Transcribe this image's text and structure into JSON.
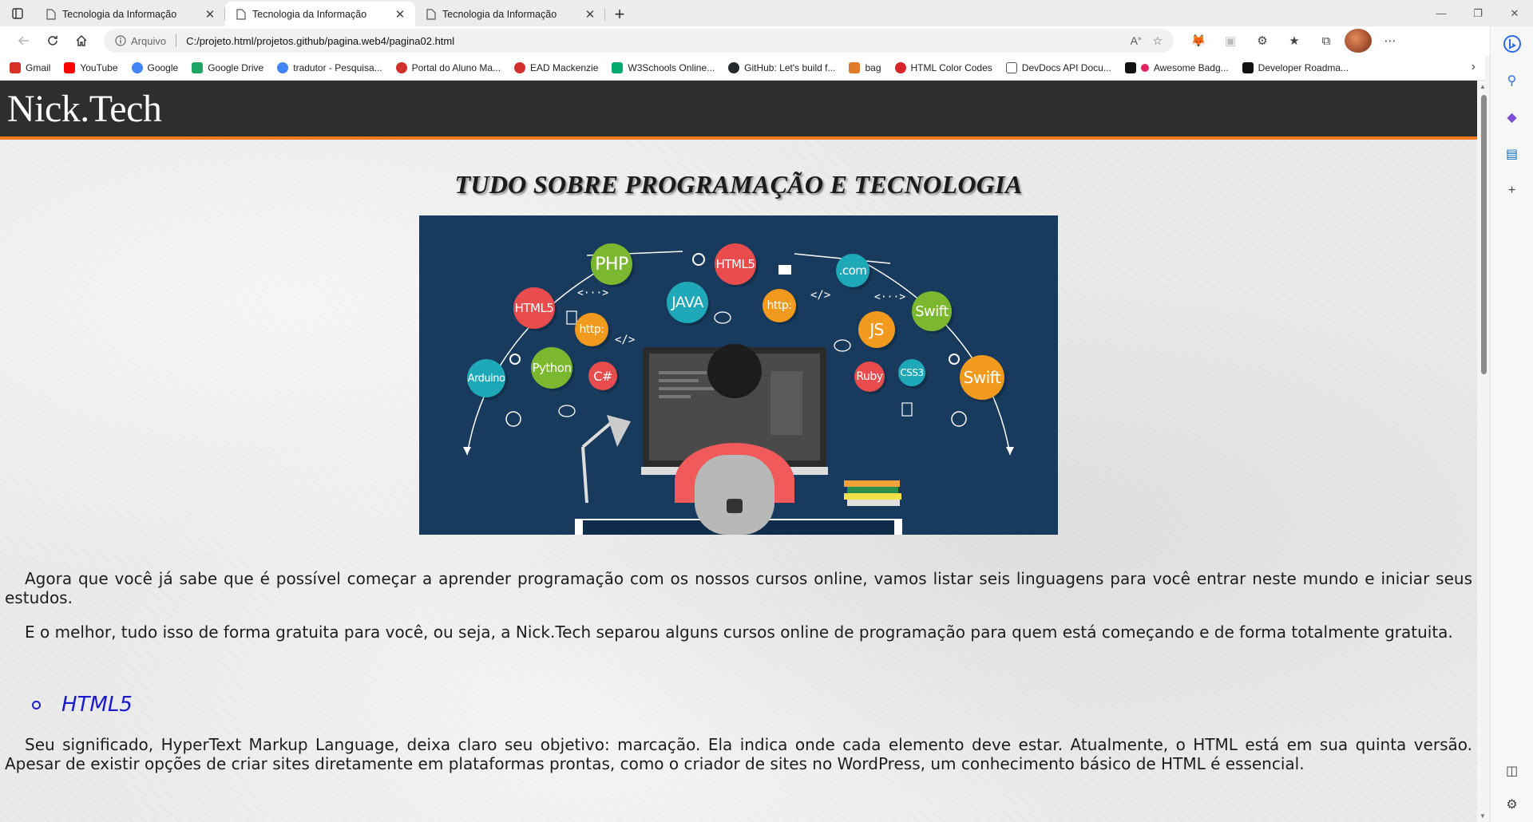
{
  "browser": {
    "tabs": [
      {
        "title": "Tecnologia da Informação",
        "active": false
      },
      {
        "title": "Tecnologia da Informação",
        "active": true
      },
      {
        "title": "Tecnologia da Informação",
        "active": false
      }
    ],
    "address": {
      "scheme_label": "Arquivo",
      "url": "C:/projeto.html/projetos.github/pagina.web4/pagina02.html"
    },
    "bookmarks": [
      {
        "label": "Gmail",
        "color": "#d93025"
      },
      {
        "label": "YouTube",
        "color": "#ff0000"
      },
      {
        "label": "Google",
        "color": "#4285f4"
      },
      {
        "label": "Google Drive",
        "color": "#1fa463"
      },
      {
        "label": "tradutor - Pesquisa...",
        "color": "#4285f4"
      },
      {
        "label": "Portal do Aluno Ma...",
        "color": "#d0312d"
      },
      {
        "label": "EAD Mackenzie",
        "color": "#d0312d"
      },
      {
        "label": "W3Schools Online...",
        "color": "#04aa6d"
      },
      {
        "label": "GitHub: Let's build f...",
        "color": "#24292e"
      },
      {
        "label": "bag",
        "color": "#e07b2a"
      },
      {
        "label": "HTML Color Codes",
        "color": "#d8232a"
      },
      {
        "label": "DevDocs API Docu...",
        "color": "#555555"
      },
      {
        "label": "Awesome Badg...",
        "color": "#e0245e"
      },
      {
        "label": "Developer Roadma...",
        "color": "#111111"
      }
    ]
  },
  "site": {
    "logo": "Nick.Tech",
    "title": "TUDO SOBRE PROGRAMAÇÃO E TECNOLOGIA",
    "paragraphs": {
      "p1": "Agora que você já sabe que é possível começar a aprender programação com os nossos cursos online, vamos listar seis linguagens para você entrar neste mundo e iniciar seus estudos.",
      "p2": "E o melhor, tudo isso de forma gratuita para você, ou seja, a Nick.Tech separou alguns cursos online de programação para quem está começando e de forma totalmente gratuita."
    },
    "list_item": "HTML5",
    "html5_text": "Seu significado, HyperText Markup Language, deixa claro seu objetivo: marcação. Ela indica onde cada elemento deve estar. Atualmente, o HTML está em sua quinta versão. Apesar de existir opções de criar sites diretamente em plataformas prontas, como o criador de sites no WordPress, um conhecimento básico de HTML é essencial."
  },
  "hero_labels": {
    "php": "PHP",
    "html5_top": "HTML5",
    "com": ".com",
    "html5_left": "HTML5",
    "java": "JAVA",
    "http_mid": "http:",
    "swift_top": "Swift",
    "http_left": "http:",
    "js": "JS",
    "python": "Python",
    "csharp": "C#",
    "arduino": "Arduino",
    "ruby": "Ruby",
    "css3": "CSS3",
    "swift_right": "Swift",
    "code_a": "<···>",
    "code_b": "</>",
    "code_c": "</>",
    "code_d": "<···>"
  },
  "colors": {
    "header_bg": "#2e2e2e",
    "header_accent": "#f47a20",
    "list_link": "#1a1acc",
    "hero_bg": "#173a5d"
  }
}
